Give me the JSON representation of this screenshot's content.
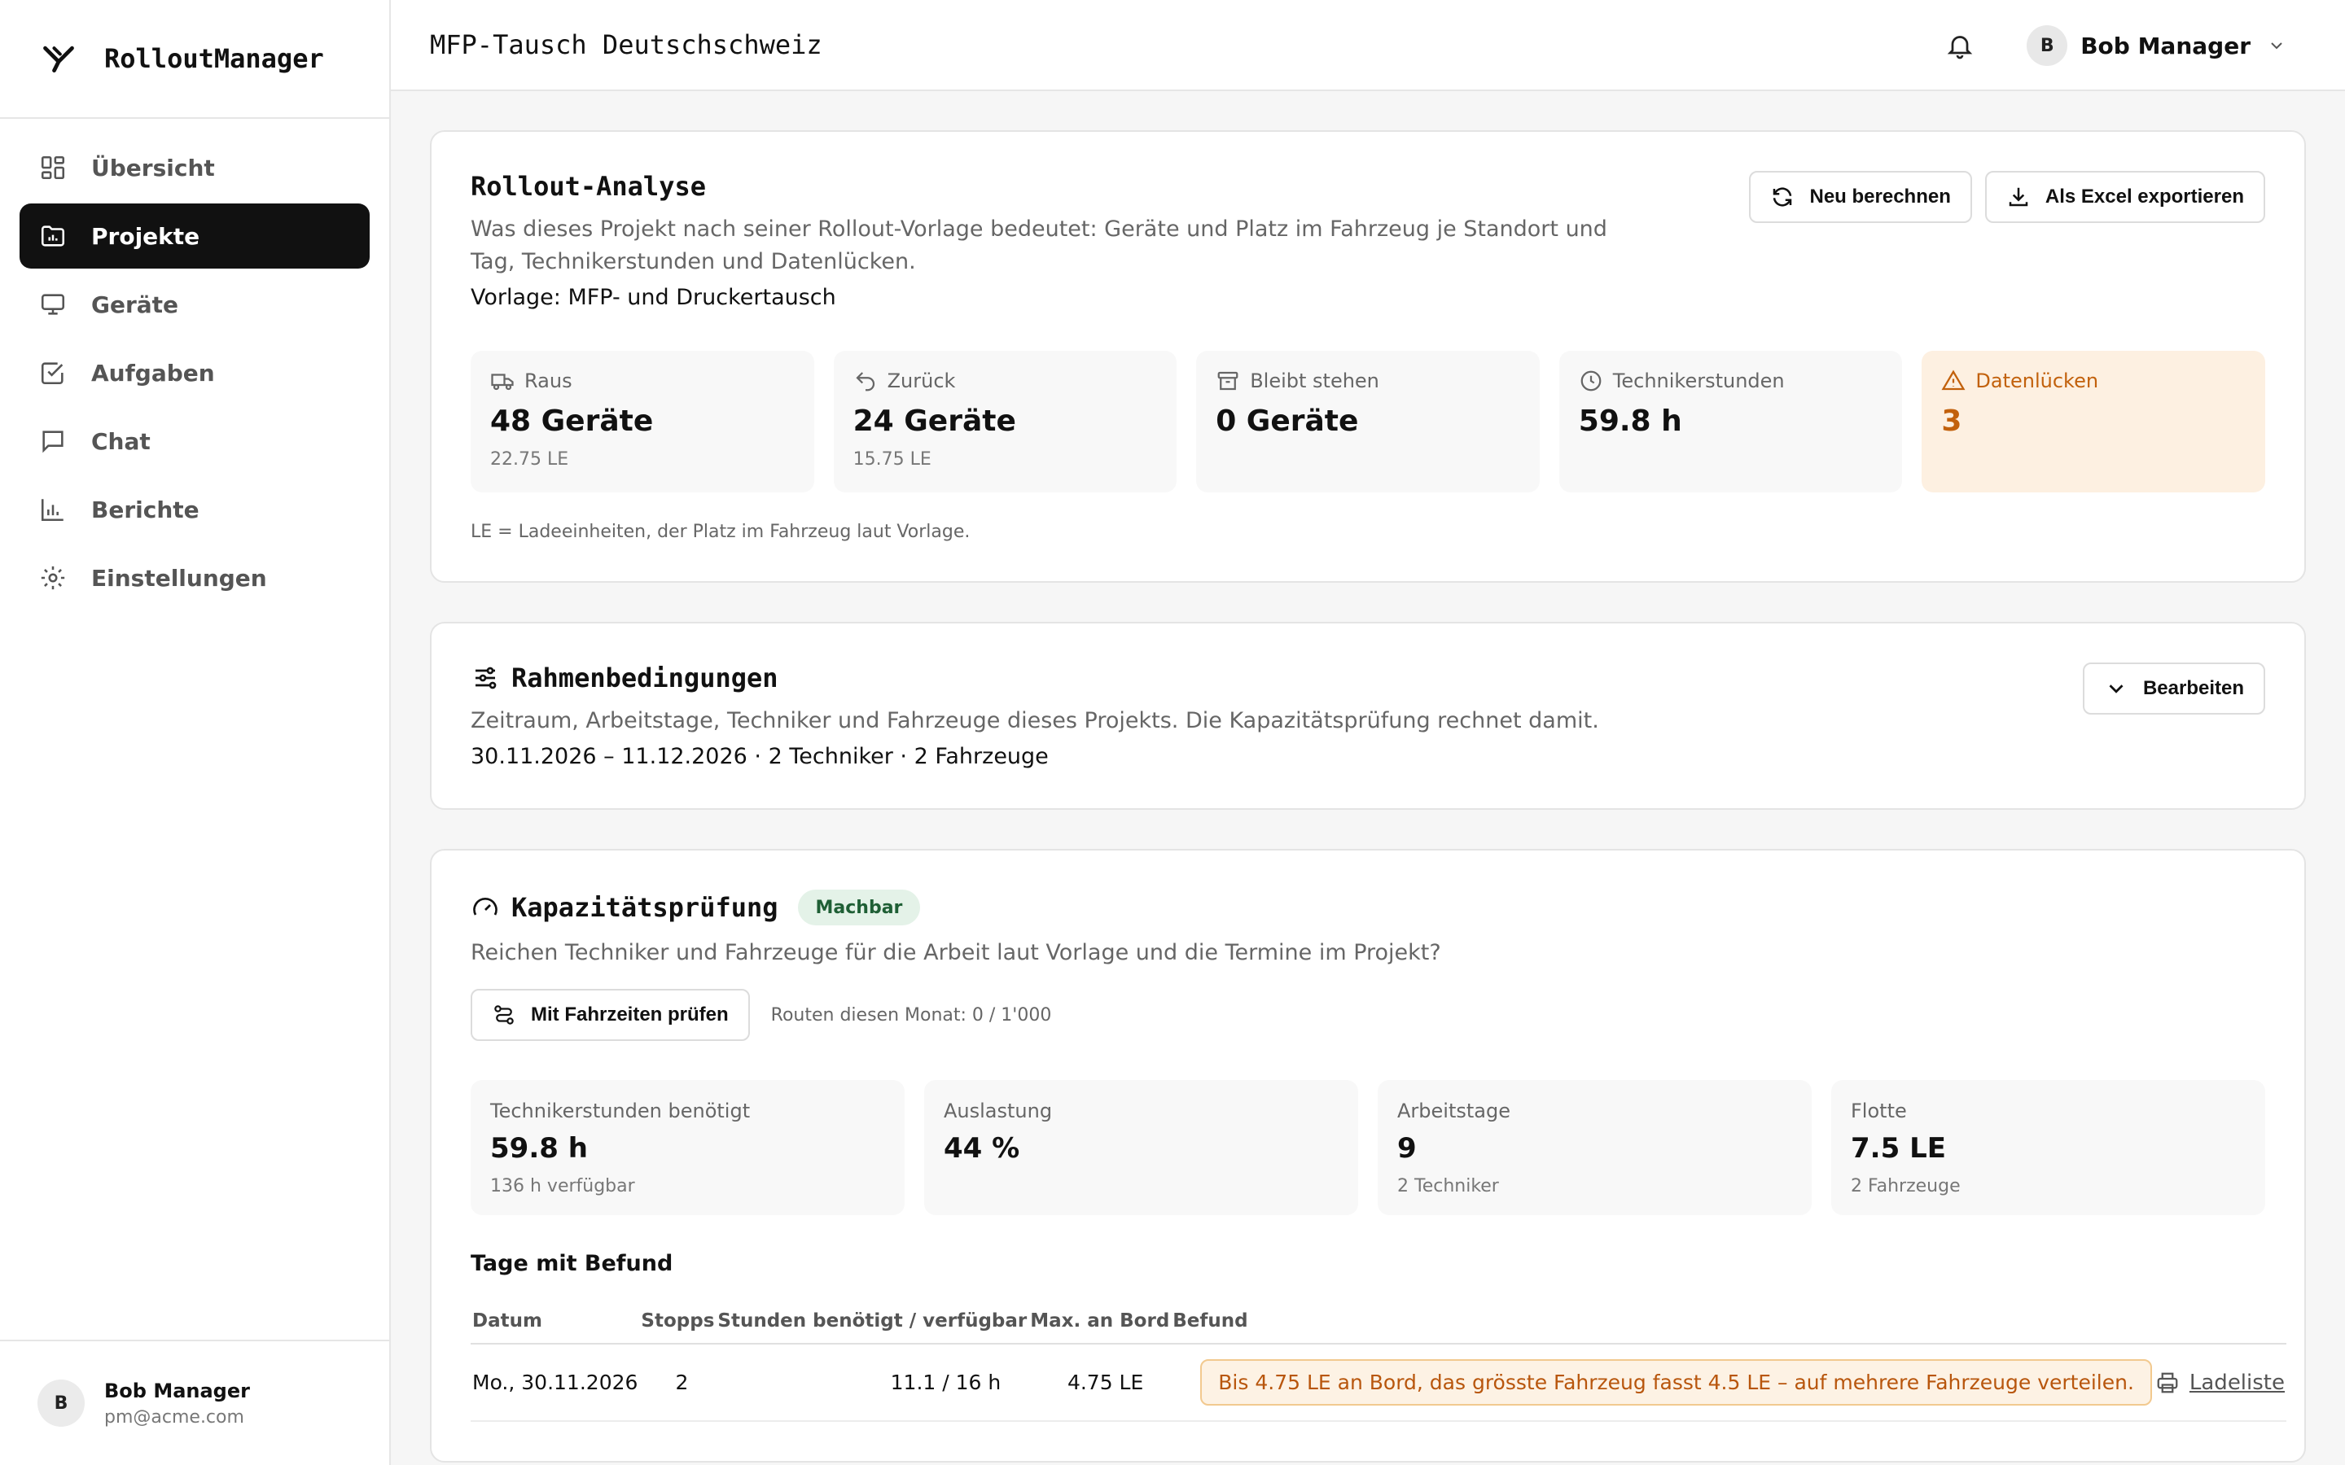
{
  "app": {
    "name": "RolloutManager"
  },
  "sidebar": {
    "items": [
      {
        "label": "Übersicht",
        "icon": "grid-icon"
      },
      {
        "label": "Projekte",
        "icon": "folder-chart-icon",
        "active": true
      },
      {
        "label": "Geräte",
        "icon": "monitor-icon"
      },
      {
        "label": "Aufgaben",
        "icon": "checkbox-icon"
      },
      {
        "label": "Chat",
        "icon": "chat-icon"
      },
      {
        "label": "Berichte",
        "icon": "bar-chart-icon"
      },
      {
        "label": "Einstellungen",
        "icon": "gear-icon"
      }
    ],
    "user": {
      "initial": "B",
      "name": "Bob Manager",
      "email": "pm@acme.com"
    }
  },
  "header": {
    "title": "MFP-Tausch Deutschschweiz",
    "user": {
      "initial": "B",
      "name": "Bob Manager"
    }
  },
  "analysis": {
    "title": "Rollout-Analyse",
    "description": "Was dieses Projekt nach seiner Rollout-Vorlage bedeutet: Geräte und Platz im Fahrzeug je Standort und Tag, Technikerstunden und Datenlücken.",
    "template": "Vorlage: MFP- und Druckertausch",
    "recalc_label": "Neu berechnen",
    "export_label": "Als Excel exportieren",
    "stats": [
      {
        "label": "Raus",
        "value": "48 Geräte",
        "sub": "22.75 LE",
        "icon": "truck-icon"
      },
      {
        "label": "Zurück",
        "value": "24 Geräte",
        "sub": "15.75 LE",
        "icon": "undo-icon"
      },
      {
        "label": "Bleibt stehen",
        "value": "0 Geräte",
        "sub": "",
        "icon": "archive-icon"
      },
      {
        "label": "Technikerstunden",
        "value": "59.8 h",
        "sub": "",
        "icon": "clock-icon"
      },
      {
        "label": "Datenlücken",
        "value": "3",
        "sub": "",
        "icon": "warning-icon"
      }
    ],
    "note": "LE = Ladeeinheiten, der Platz im Fahrzeug laut Vorlage."
  },
  "constraints": {
    "title": "Rahmenbedingungen",
    "description": "Zeitraum, Arbeitstage, Techniker und Fahrzeuge dieses Projekts. Die Kapazitätsprüfung rechnet damit.",
    "summary": "30.11.2026 – 11.12.2026 · 2 Techniker · 2 Fahrzeuge",
    "edit_label": "Bearbeiten"
  },
  "capacity": {
    "title": "Kapazitätsprüfung",
    "badge": "Machbar",
    "description": "Reichen Techniker und Fahrzeuge für die Arbeit laut Vorlage und die Termine im Projekt?",
    "check_label": "Mit Fahrzeiten prüfen",
    "routes": "Routen diesen Monat: 0 / 1'000",
    "kpis": [
      {
        "label": "Technikerstunden benötigt",
        "value": "59.8 h",
        "sub": "136 h verfügbar"
      },
      {
        "label": "Auslastung",
        "value": "44 %",
        "sub": ""
      },
      {
        "label": "Arbeitstage",
        "value": "9",
        "sub": "2 Techniker"
      },
      {
        "label": "Flotte",
        "value": "7.5 LE",
        "sub": "2 Fahrzeuge"
      }
    ],
    "days_title": "Tage mit Befund",
    "columns": [
      "Datum",
      "Stopps",
      "Stunden benötigt / verfügbar",
      "Max. an Bord",
      "Befund"
    ],
    "rows": [
      {
        "date": "Mo., 30.11.2026",
        "stops": "2",
        "hours": "11.1 / 16 h",
        "max_on_board": "4.75 LE",
        "finding": "Bis 4.75 LE an Bord, das grösste Fahrzeug fasst 4.5 LE – auf mehrere Fahrzeuge verteilen.",
        "action": "Ladeliste"
      }
    ]
  }
}
